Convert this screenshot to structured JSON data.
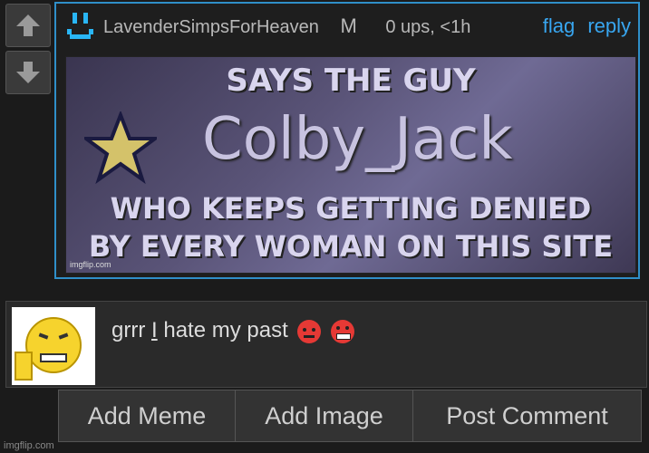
{
  "comment": {
    "username": "LavenderSimpsForHeaven",
    "badge": "M",
    "stats": "0 ups, <1h",
    "actions": {
      "flag": "flag",
      "reply": "reply"
    },
    "meme": {
      "line1": "SAYS THE GUY",
      "line2": "Colby_Jack",
      "line3": "WHO KEEPS GETTING DENIED",
      "line4": "BY EVERY WOMAN ON THIS SITE",
      "watermark": "imgflip.com"
    }
  },
  "compose": {
    "text_before": "grrr ",
    "text_caret": "I",
    "text_after": " hate my past"
  },
  "buttons": {
    "add_meme": "Add Meme",
    "add_image": "Add Image",
    "post_comment": "Post Comment"
  },
  "footer": {
    "watermark": "imgflip.com"
  },
  "colors": {
    "accent": "#2f8fc9",
    "link": "#38a6f0",
    "background": "#1b1b1b"
  }
}
